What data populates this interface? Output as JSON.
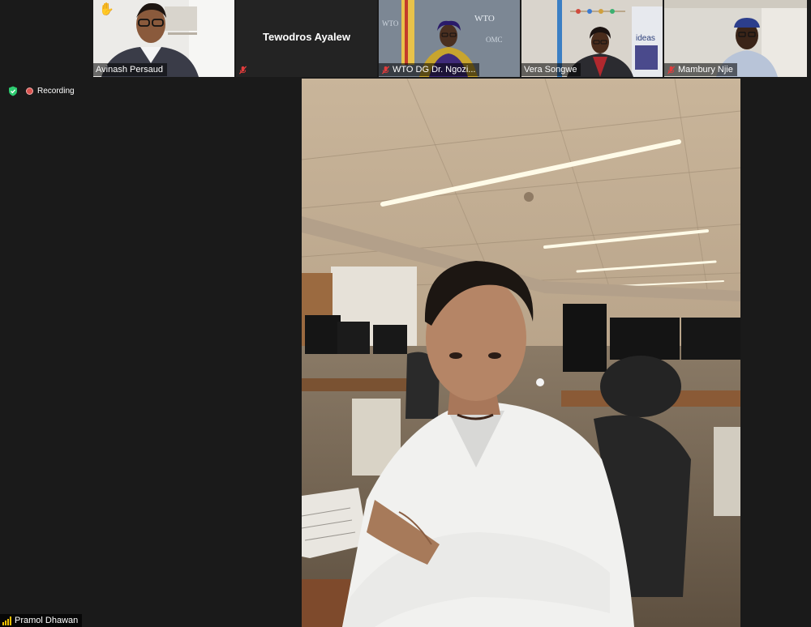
{
  "participants": [
    {
      "name": "Avinash Persaud",
      "hand_raised": true
    },
    {
      "name": "Tewodros Ayalew",
      "video_off": true,
      "muted": true
    },
    {
      "name": "WTO DG Dr. Ngozi...",
      "muted": true
    },
    {
      "name": "Vera Songwe"
    },
    {
      "name": "Mambury Njie",
      "muted": true
    }
  ],
  "status": {
    "recording_label": "Recording",
    "shield_icon": "shield-check-icon"
  },
  "speaker": {
    "name": "Pramol Dhawan"
  },
  "colors": {
    "background": "#1a1a1a",
    "recording_dot": "#d9534f",
    "shield": "#2ecc71",
    "mute_red": "#e23c3c"
  }
}
